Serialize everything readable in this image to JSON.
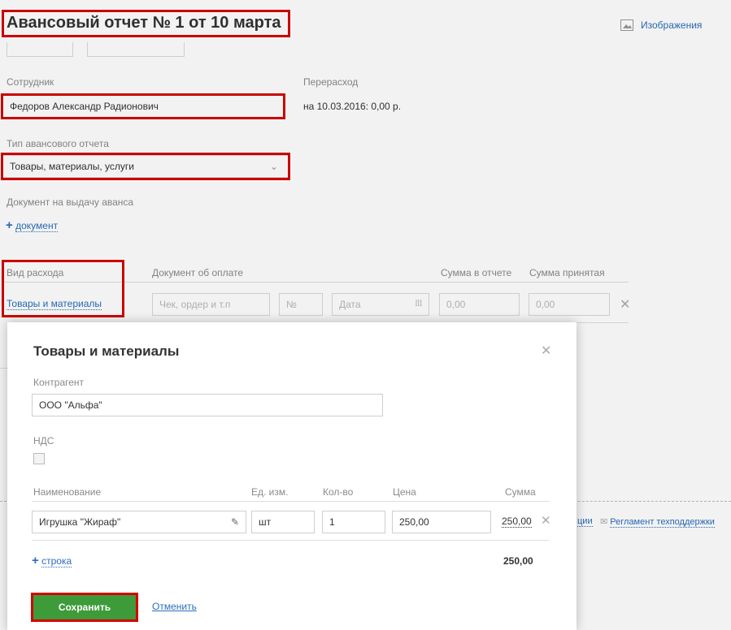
{
  "page": {
    "title": "Авансовый отчет № 1 от 10 марта",
    "images_link": "Изображения",
    "employee_label": "Сотрудник",
    "employee_value": "Федоров Александр Радионович",
    "overspend_label": "Перерасход",
    "overspend_value": "на 10.03.2016: 0,00 р.",
    "report_type_label": "Тип авансового отчета",
    "report_type_value": "Товары, материалы, услуги",
    "advance_doc_label": "Документ на выдачу аванса",
    "add_document_link": "документ",
    "expense_table": {
      "headers": [
        "Вид расхода",
        "Документ об оплате",
        "Сумма в отчете",
        "Сумма принятая"
      ],
      "row": {
        "expense_type": "Товары и материалы",
        "doc_placeholder": "Чек, ордер и т.п",
        "number_placeholder": "№",
        "date_placeholder": "Дата",
        "sum_report": "0,00",
        "sum_accepted": "0,00"
      }
    },
    "footer_link": "Регламент техподдержки",
    "footer_partial": "ции"
  },
  "modal": {
    "title": "Товары и материалы",
    "counterparty_label": "Контрагент",
    "counterparty_value": "ООО \"Альфа\"",
    "vat_label": "НДС",
    "columns": [
      "Наименование",
      "Ед. изм.",
      "Кол-во",
      "Цена",
      "Сумма"
    ],
    "row": {
      "name": "Игрушка \"Жираф\"",
      "unit": "шт",
      "qty": "1",
      "price": "250,00",
      "sum": "250,00"
    },
    "add_row_link": "строка",
    "total": "250,00",
    "save_button": "Сохранить",
    "cancel_link": "Отменить"
  },
  "colors": {
    "accent_link": "#2a6ebb",
    "save_green": "#3e9b3a",
    "highlight_red": "#d50000"
  }
}
